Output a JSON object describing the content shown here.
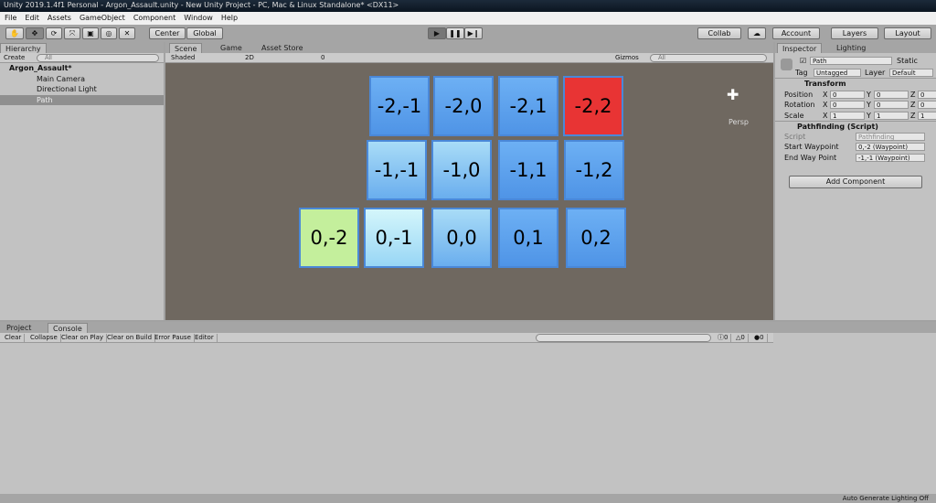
{
  "title": "Unity 2019.1.4f1 Personal - Argon_Assault.unity - New Unity Project - PC, Mac & Linux Standalone* <DX11>",
  "menu": [
    "File",
    "Edit",
    "Assets",
    "GameObject",
    "Component",
    "Window",
    "Help"
  ],
  "toolbar": {
    "center": "Center",
    "global": "Global",
    "collab": "Collab",
    "account": "Account",
    "layers": "Layers",
    "layout": "Layout"
  },
  "hierarchy": {
    "tab": "Hierarchy",
    "create": "Create",
    "search_placeholder": "All",
    "scene": "Argon_Assault*",
    "items": [
      "Main Camera",
      "Directional Light",
      "Path"
    ]
  },
  "scene": {
    "tabs": [
      "Scene",
      "Game",
      "Asset Store"
    ],
    "shading": "Shaded",
    "mode2d": "2D",
    "gizmos": "Gizmos",
    "search_placeholder": "All",
    "hidden_count": "0",
    "persp": "Persp",
    "tiles": [
      {
        "label": "-2,-1",
        "color": "blue"
      },
      {
        "label": "-2,0",
        "color": "blue"
      },
      {
        "label": "-2,1",
        "color": "blue"
      },
      {
        "label": "-2,2",
        "color": "#e83434"
      },
      {
        "label": "-1,-1",
        "color": "light"
      },
      {
        "label": "-1,0",
        "color": "light"
      },
      {
        "label": "-1,1",
        "color": "blue"
      },
      {
        "label": "-1,2",
        "color": "blue"
      },
      {
        "label": "0,-2",
        "color": "#c4ef9c"
      },
      {
        "label": "0,-1",
        "color": "cyan"
      },
      {
        "label": "0,0",
        "color": "light"
      },
      {
        "label": "0,1",
        "color": "blue"
      },
      {
        "label": "0,2",
        "color": "blue"
      }
    ]
  },
  "inspector": {
    "tabs": [
      "Inspector",
      "Lighting"
    ],
    "name": "Path",
    "static": "Static",
    "tag_label": "Tag",
    "tag": "Untagged",
    "layer_label": "Layer",
    "layer": "Default",
    "transform": {
      "title": "Transform",
      "rows": [
        {
          "label": "Position",
          "x": "0",
          "y": "0",
          "z": "0"
        },
        {
          "label": "Rotation",
          "x": "0",
          "y": "0",
          "z": "0"
        },
        {
          "label": "Scale",
          "x": "1",
          "y": "1",
          "z": "1"
        }
      ]
    },
    "script": {
      "title": "Pathfinding (Script)",
      "script_label": "Script",
      "script_value": "Pathfinding",
      "start_label": "Start Waypoint",
      "start_value": "0,-2 (Waypoint)",
      "end_label": "End Way Point",
      "end_value": "-1,-1 (Waypoint)"
    },
    "add_component": "Add Component"
  },
  "console": {
    "tabs": [
      "Project",
      "Console"
    ],
    "buttons": [
      "Clear",
      "Collapse",
      "Clear on Play",
      "Clear on Build",
      "Error Pause",
      "Editor"
    ],
    "counts": [
      "0",
      "0",
      "0"
    ]
  },
  "status": "Auto Generate Lighting Off"
}
